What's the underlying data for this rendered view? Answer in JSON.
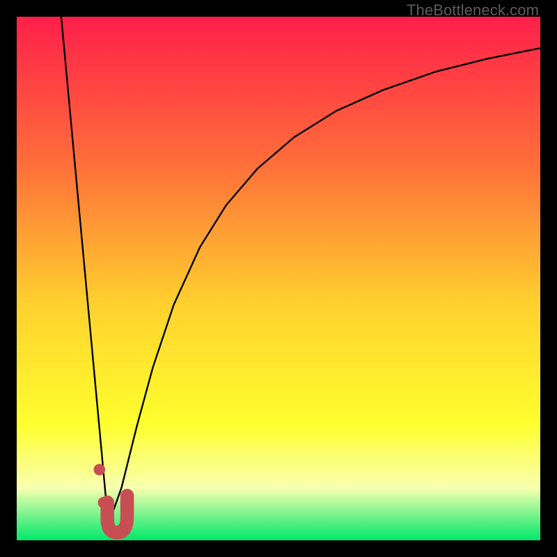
{
  "watermark": "TheBottleneck.com",
  "colors": {
    "gradient_top": "#ff1f4a",
    "gradient_mid1": "#ff6e3a",
    "gradient_mid2": "#ffd12e",
    "gradient_mid3": "#ffff2e",
    "gradient_mid4": "#f8ffb0",
    "gradient_bottom": "#00e86b",
    "curve": "#000000",
    "marker_fill": "#c74f53",
    "marker_stroke": "#c74f53"
  },
  "chart_data": {
    "type": "line",
    "title": "",
    "xlabel": "",
    "ylabel": "",
    "xlim": [
      0,
      100
    ],
    "ylim": [
      0,
      100
    ],
    "series": [
      {
        "name": "left-branch",
        "x": [
          8.5,
          17.5
        ],
        "y": [
          100,
          3
        ]
      },
      {
        "name": "right-branch",
        "x": [
          17.5,
          20,
          23,
          26,
          30,
          35,
          40,
          46,
          53,
          61,
          70,
          80,
          90,
          100
        ],
        "y": [
          3,
          10,
          22,
          33,
          45,
          56,
          64,
          71,
          77,
          82,
          86,
          89.5,
          92,
          94
        ]
      }
    ],
    "markers": [
      {
        "shape": "dot",
        "x": 15.8,
        "y": 13.5,
        "r": 1.1
      },
      {
        "shape": "dot",
        "x": 16.6,
        "y": 7.2,
        "r": 1.1
      },
      {
        "shape": "round-j",
        "cx": 19.2,
        "cy": 5.0,
        "width": 4.2,
        "height": 6.4,
        "stroke": 2.6
      }
    ]
  }
}
